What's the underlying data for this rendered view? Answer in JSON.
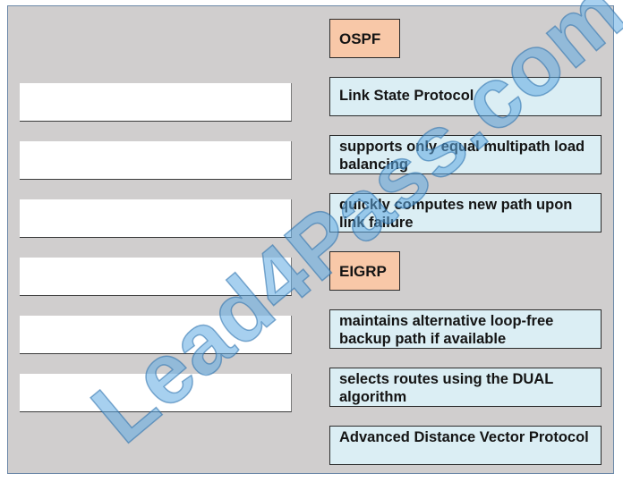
{
  "targets": [
    {
      "label": ""
    },
    {
      "label": ""
    },
    {
      "label": ""
    },
    {
      "label": ""
    },
    {
      "label": ""
    },
    {
      "label": ""
    }
  ],
  "items": [
    {
      "text": "OSPF",
      "kind": "category"
    },
    {
      "text": "Link State Protocol",
      "kind": "option"
    },
    {
      "text": "supports only equal multipath load balancing",
      "kind": "option"
    },
    {
      "text": "quickly computes new path upon link failure",
      "kind": "option"
    },
    {
      "text": "EIGRP",
      "kind": "category"
    },
    {
      "text": "maintains alternative loop-free backup path if available",
      "kind": "option"
    },
    {
      "text": "selects routes using the DUAL algorithm",
      "kind": "option"
    },
    {
      "text": "Advanced Distance Vector Protocol",
      "kind": "option"
    }
  ],
  "watermark": "Lead4Pass.com",
  "colors": {
    "background": "#d0cece",
    "option_fill": "#dbeef4",
    "category_fill": "#f8c8a8",
    "target_fill": "#ffffff"
  }
}
